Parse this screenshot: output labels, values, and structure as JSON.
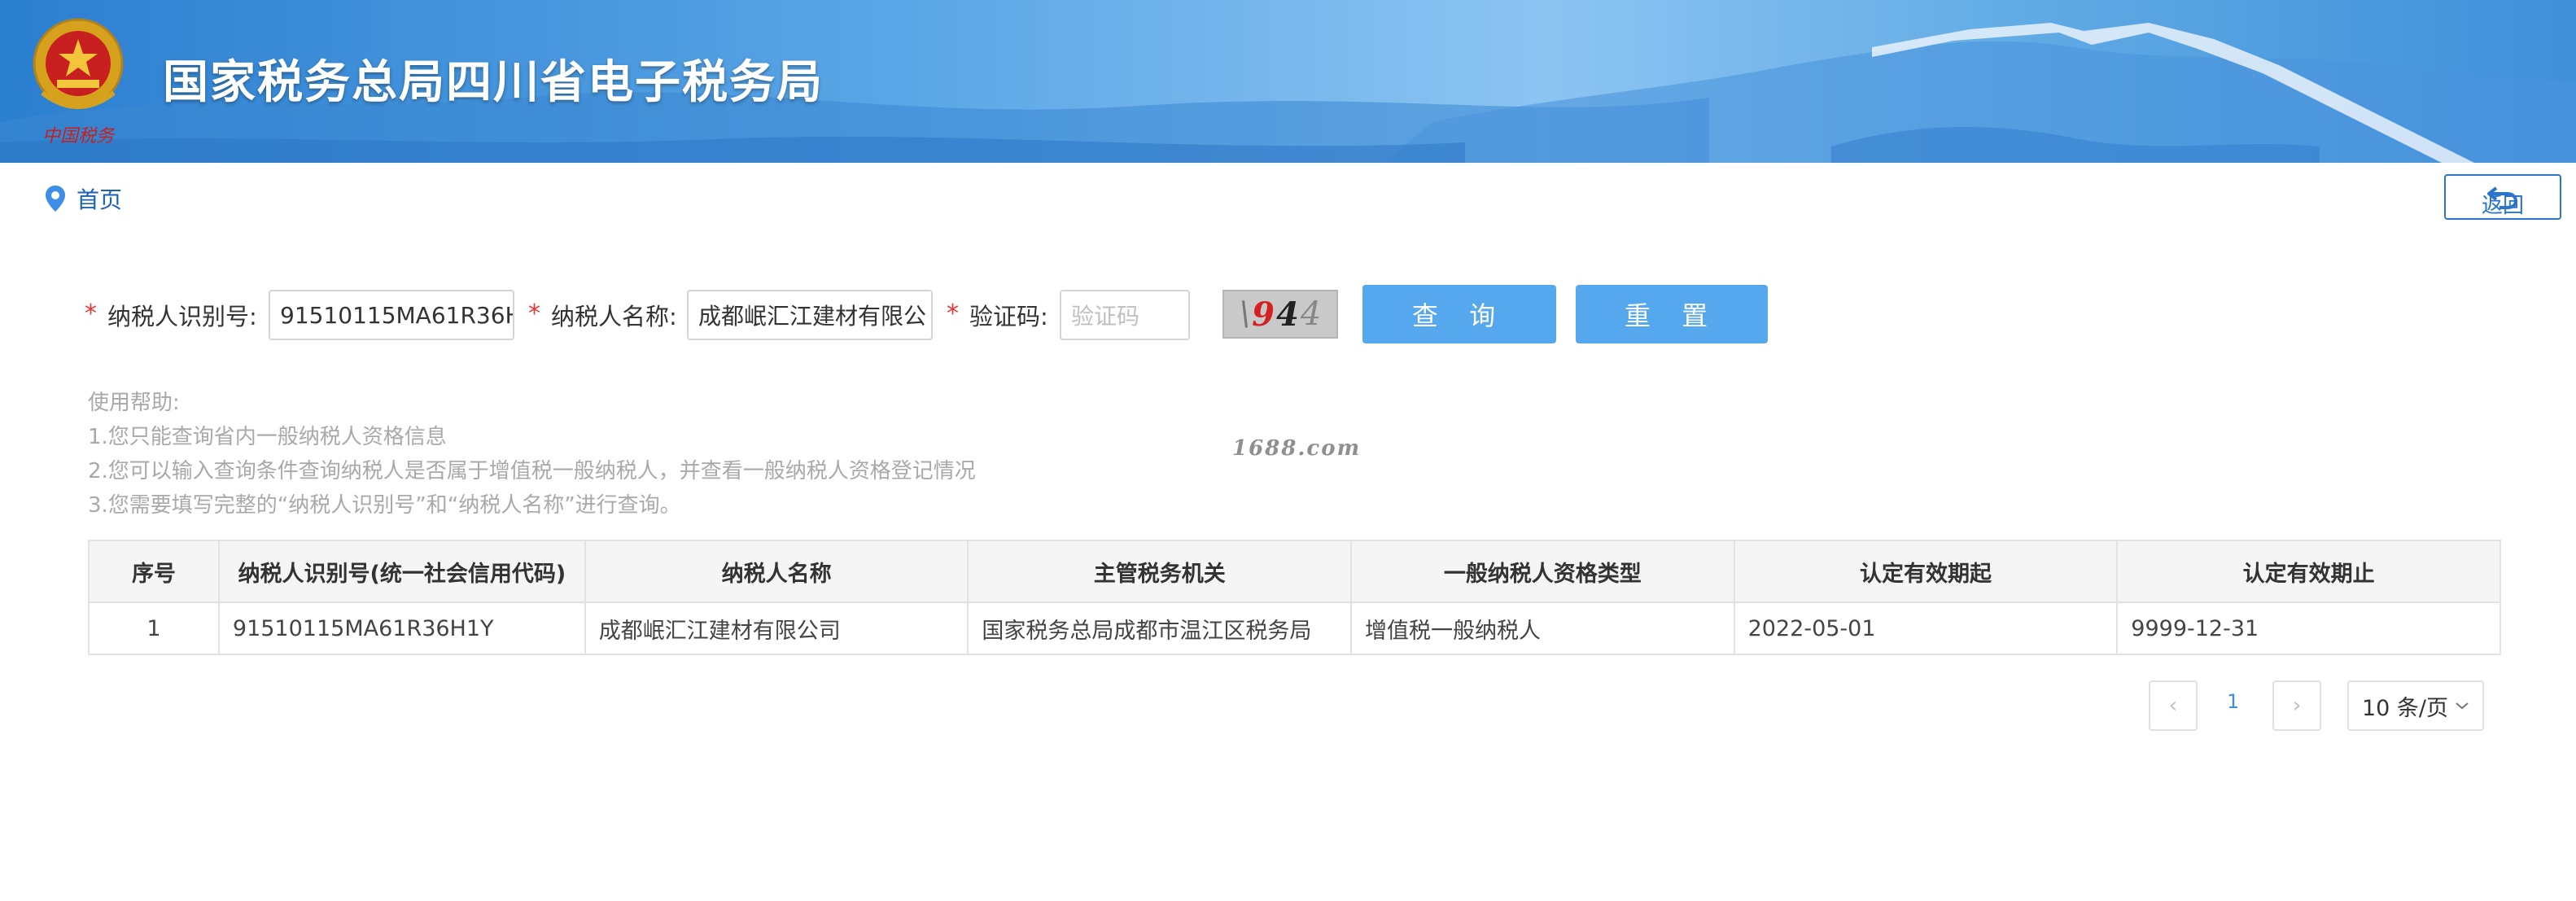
{
  "header": {
    "site_title": "国家税务总局四川省电子税务局",
    "emblem_caption": "中国税务"
  },
  "breadcrumb": {
    "home_label": "首页"
  },
  "back_button": {
    "label": "返回"
  },
  "form": {
    "taxpayer_id": {
      "label": "纳税人识别号:",
      "value": "91510115MA61R36H",
      "required": true
    },
    "taxpayer_name": {
      "label": "纳税人名称:",
      "value": "成都岷汇江建材有限公",
      "required": true
    },
    "captcha": {
      "label": "验证码:",
      "placeholder": "验证码",
      "required": true,
      "image_chars": [
        "\\",
        "9",
        "4",
        "4"
      ]
    },
    "query_button": "查 询",
    "reset_button": "重 置"
  },
  "help": {
    "title": "使用帮助:",
    "lines": [
      "1.您只能查询省内一般纳税人资格信息",
      "2.您可以输入查询条件查询纳税人是否属于增值税一般纳税人，并查看一般纳税人资格登记情况",
      "3.您需要填写完整的“纳税人识别号”和“纳税人名称”进行查询。"
    ]
  },
  "watermark": "1688.com",
  "table": {
    "columns": [
      "序号",
      "纳税人识别号(统一社会信用代码)",
      "纳税人名称",
      "主管税务机关",
      "一般纳税人资格类型",
      "认定有效期起",
      "认定有效期止"
    ],
    "rows": [
      [
        "1",
        "91510115MA61R36H1Y",
        "成都岷汇江建材有限公司",
        "国家税务总局成都市温江区税务局",
        "增值税一般纳税人",
        "2022-05-01",
        "9999-12-31"
      ]
    ]
  },
  "pagination": {
    "prev": "‹",
    "current_page": "1",
    "next": "›",
    "page_size": "10 条/页"
  },
  "colors": {
    "accent": "#55a7ee",
    "link": "#1a62b8",
    "required": "#e33333"
  }
}
